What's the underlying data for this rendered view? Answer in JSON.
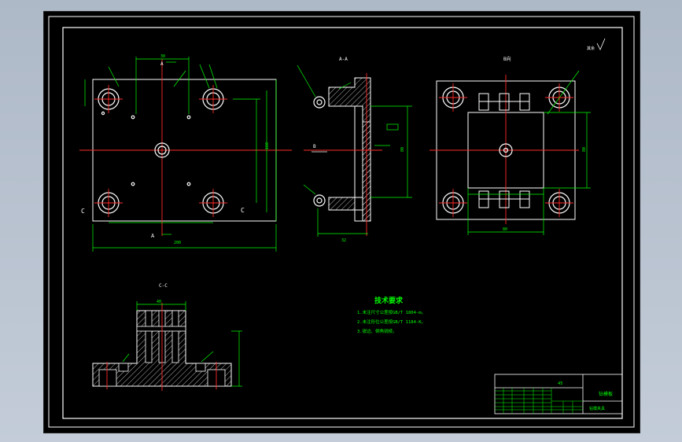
{
  "colors": {
    "background": "#000000",
    "outline": "#ffffff",
    "centerline": "#ff2a2a",
    "dimension": "#00ff00",
    "desktop": "#b8c2d0"
  },
  "views": {
    "section_aa_label": "A-A",
    "section_cc_label": "C-C",
    "view_b_label": "B",
    "marker_c": "C",
    "marker_a": "A"
  },
  "tech_requirements": {
    "title": "技术要求",
    "items": [
      "1.未注尺寸公差按GB/T 1804-m。",
      "2.未注形位公差按GB/T 1184-K。",
      "3.锐边、倒角锐棱。"
    ]
  },
  "title_block": {
    "part_name": "钻模板",
    "drawing_no": "",
    "material": "45",
    "school": "钻模夹具"
  }
}
